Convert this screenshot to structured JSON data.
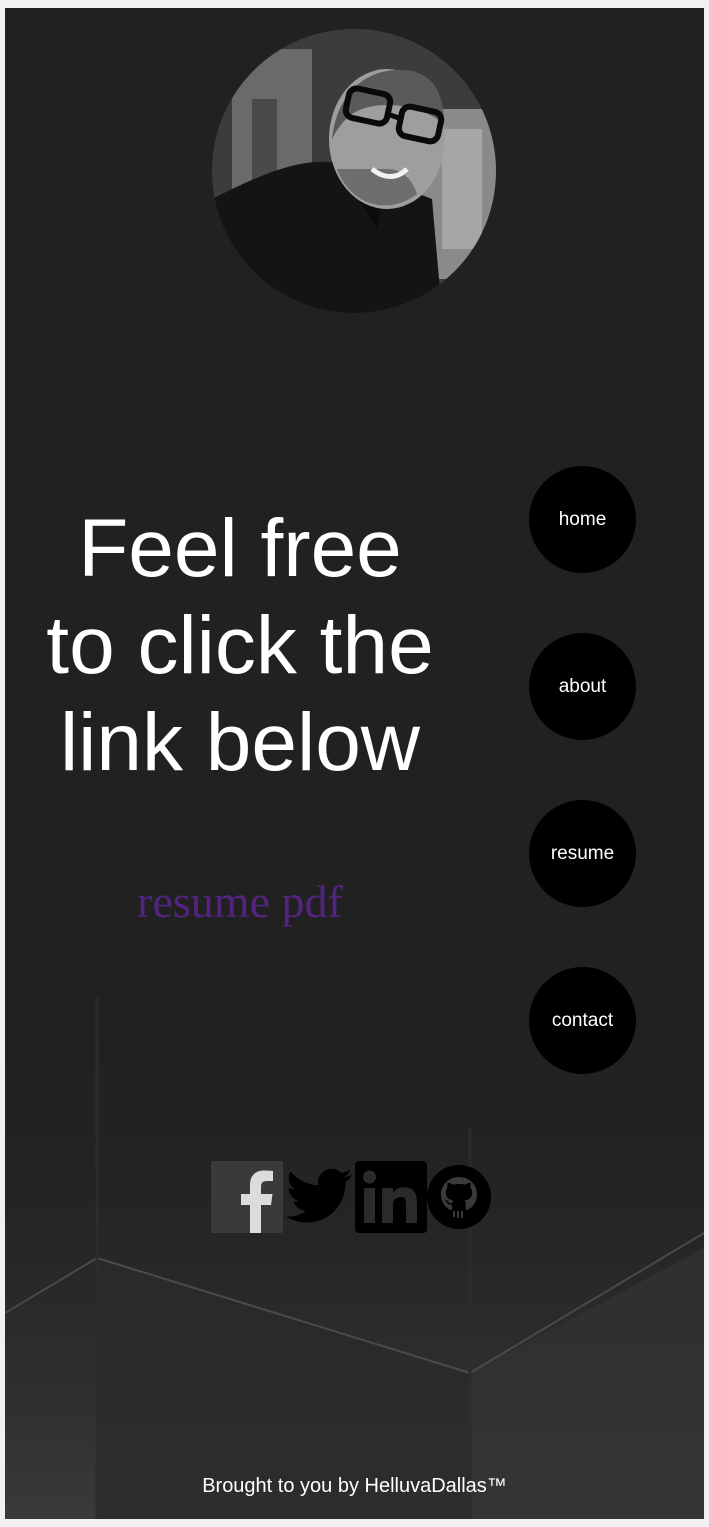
{
  "profile": {
    "photo_alt": "profile photo"
  },
  "main": {
    "headline_line1": "Feel free",
    "headline_line2": "to click the",
    "headline_line3": "link below",
    "resume_link": "resume pdf"
  },
  "nav": {
    "items": [
      {
        "label": "home"
      },
      {
        "label": "about"
      },
      {
        "label": "resume"
      },
      {
        "label": "contact"
      }
    ]
  },
  "social": {
    "icons": [
      "facebook-icon",
      "twitter-icon",
      "linkedin-icon",
      "github-icon"
    ]
  },
  "footer": {
    "text": "Brought to you by HelluvaDallas™"
  },
  "colors": {
    "background": "#212121",
    "nav_circle": "#000000",
    "link": "#52247f",
    "text": "#ffffff"
  }
}
